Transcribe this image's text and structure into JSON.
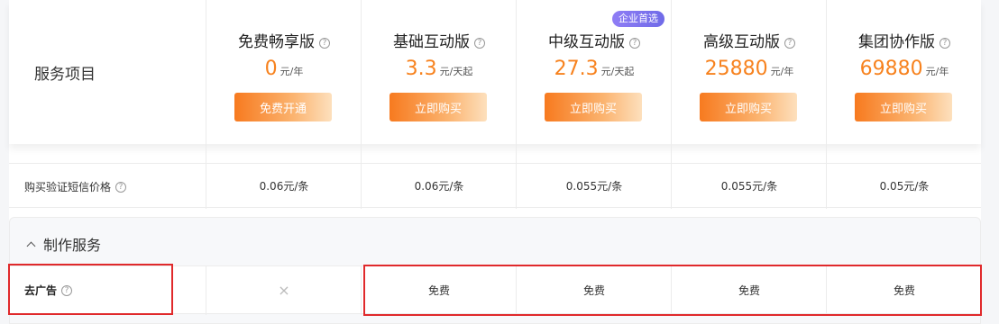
{
  "header": {
    "service_label": "服务项目",
    "plans": [
      {
        "name": "免费畅享版",
        "price": "0",
        "unit": "元/年",
        "button": "免费开通",
        "badge": ""
      },
      {
        "name": "基础互动版",
        "price": "3.3",
        "unit": "元/天起",
        "button": "立即购买",
        "badge": ""
      },
      {
        "name": "中级互动版",
        "price": "27.3",
        "unit": "元/天起",
        "button": "立即购买",
        "badge": "企业首选"
      },
      {
        "name": "高级互动版",
        "price": "25880",
        "unit": "元/年",
        "button": "立即购买",
        "badge": ""
      },
      {
        "name": "集团协作版",
        "price": "69880",
        "unit": "元/年",
        "button": "立即购买",
        "badge": ""
      }
    ]
  },
  "sms_row": {
    "label": "购买验证短信价格",
    "values": [
      "0.06元/条",
      "0.06元/条",
      "0.055元/条",
      "0.055元/条",
      "0.05元/条"
    ]
  },
  "section": {
    "title": "制作服务",
    "rows": [
      {
        "label": "去广告",
        "values": [
          "×",
          "免费",
          "免费",
          "免费",
          "免费"
        ]
      }
    ]
  },
  "colors": {
    "accent_orange": "#f7821e",
    "badge_purple": "#7d72f0",
    "highlight_red": "#e0292b"
  }
}
